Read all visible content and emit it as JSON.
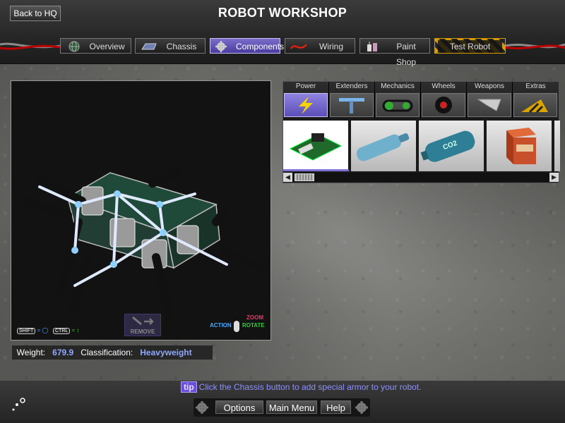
{
  "header": {
    "title": "ROBOT WORKSHOP",
    "back_label": "Back to HQ"
  },
  "tabs": [
    {
      "label": "Overview",
      "icon": "globe-icon"
    },
    {
      "label": "Chassis",
      "icon": "chassis-plate-icon"
    },
    {
      "label": "Components",
      "icon": "gear-icon",
      "active": true
    },
    {
      "label": "Wiring",
      "icon": "wire-icon"
    },
    {
      "label": "Paint Shop",
      "icon": "paint-cans-icon"
    },
    {
      "label": "Test Robot",
      "icon": "hazard-stripes"
    }
  ],
  "viewport": {
    "remove_label": "REMOVE",
    "shift_key": "SHIFT",
    "ctrl_key": "CTRL",
    "action_label": "ACTION",
    "zoom_label": "ZOOM",
    "rotate_label": "ROTATE"
  },
  "stats": {
    "weight_label": "Weight:",
    "weight_value": "679.9",
    "class_label": "Classification:",
    "class_value": "Heavyweight"
  },
  "parts": {
    "categories": [
      {
        "label": "Power",
        "icon": "lightning-icon",
        "active": true
      },
      {
        "label": "Extenders",
        "icon": "extender-bar-icon"
      },
      {
        "label": "Mechanics",
        "icon": "chain-drive-icon"
      },
      {
        "label": "Wheels",
        "icon": "wheel-icon"
      },
      {
        "label": "Weapons",
        "icon": "blade-icon"
      },
      {
        "label": "Extras",
        "icon": "hazard-wedge-icon"
      }
    ],
    "items": [
      {
        "name": "circuit-board",
        "selected": true
      },
      {
        "name": "blue-tank"
      },
      {
        "name": "co2-tank",
        "text": "CO2"
      },
      {
        "name": "battery-box"
      }
    ]
  },
  "footer": {
    "tip_badge": "tip",
    "tip_text": "Click the Chassis button to add special armor to your robot.",
    "options_label": "Options",
    "mainmenu_label": "Main Menu",
    "help_label": "Help"
  },
  "colors": {
    "accent": "#5b4fb8",
    "stat_value": "#8fa8ff",
    "tip_text": "#8f8fff"
  }
}
